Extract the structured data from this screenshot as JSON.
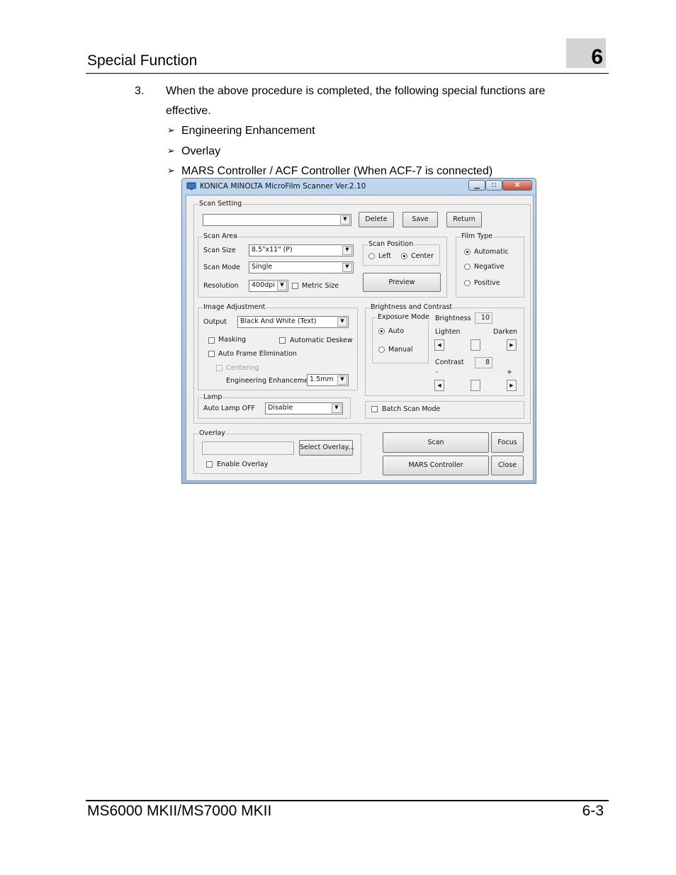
{
  "page": {
    "header_title": "Special Function",
    "chapter_number": "6",
    "step_number": "3.",
    "step_text_line1": "When the above procedure is completed, the following special functions are",
    "step_text_line2": "effective.",
    "bullet_marker": "➢",
    "bullets": [
      "Engineering Enhancement",
      "Overlay",
      "MARS Controller / ACF Controller (When ACF-7 is connected)"
    ],
    "footer_left": "MS6000 MKII/MS7000 MKII",
    "footer_right": "6-3"
  },
  "window": {
    "title": "KONICA MINOLTA MicroFilm Scanner Ver.2.10",
    "caption_min": "▁",
    "caption_max": "□",
    "caption_close": "✕",
    "scan_setting": {
      "legend": "Scan Setting",
      "selected": "",
      "delete_label": "Delete",
      "save_label": "Save",
      "return_label": "Return"
    },
    "scan_area": {
      "legend": "Scan Area",
      "scan_size_label": "Scan Size",
      "scan_size_value": "8.5\"x11\" (P)",
      "scan_mode_label": "Scan Mode",
      "scan_mode_value": "Single",
      "resolution_label": "Resolution",
      "resolution_value": "400dpi",
      "metric_size_label": "Metric Size",
      "scan_position": {
        "legend": "Scan Position",
        "left_label": "Left",
        "center_label": "Center"
      },
      "preview_label": "Preview"
    },
    "film_type": {
      "legend": "Film Type",
      "automatic_label": "Automatic",
      "negative_label": "Negative",
      "positive_label": "Positive"
    },
    "image_adjustment": {
      "legend": "Image Adjustment",
      "output_label": "Output",
      "output_value": "Black And White (Text)",
      "masking_label": "Masking",
      "auto_deskew_label": "Automatic Deskew",
      "auto_frame_label": "Auto Frame Elimination",
      "centering_label": "Centering",
      "eng_enh_label": "Engineering Enhancement",
      "eng_enh_value": "1.5mm"
    },
    "brightness_contrast": {
      "legend": "Brightness and Contrast",
      "exposure_legend": "Exposure Mode",
      "auto_label": "Auto",
      "manual_label": "Manual",
      "brightness_label": "Brightness",
      "brightness_value": "10",
      "lighten_label": "Lighten",
      "darken_label": "Darken",
      "contrast_label": "Contrast",
      "contrast_value": "8",
      "minus_label": "-",
      "plus_label": "+",
      "arrow_left": "◀",
      "arrow_right": "▶"
    },
    "lamp": {
      "legend": "Lamp",
      "auto_lamp_label": "Auto Lamp OFF",
      "auto_lamp_value": "Disable"
    },
    "batch_scan_label": "Batch Scan Mode",
    "overlay": {
      "legend": "Overlay",
      "path_value": "",
      "select_label": "Select Overlay...",
      "enable_label": "Enable Overlay"
    },
    "scan_label": "Scan",
    "focus_label": "Focus",
    "mars_label": "MARS Controller",
    "close_label": "Close",
    "combo_arrow": "▼"
  }
}
